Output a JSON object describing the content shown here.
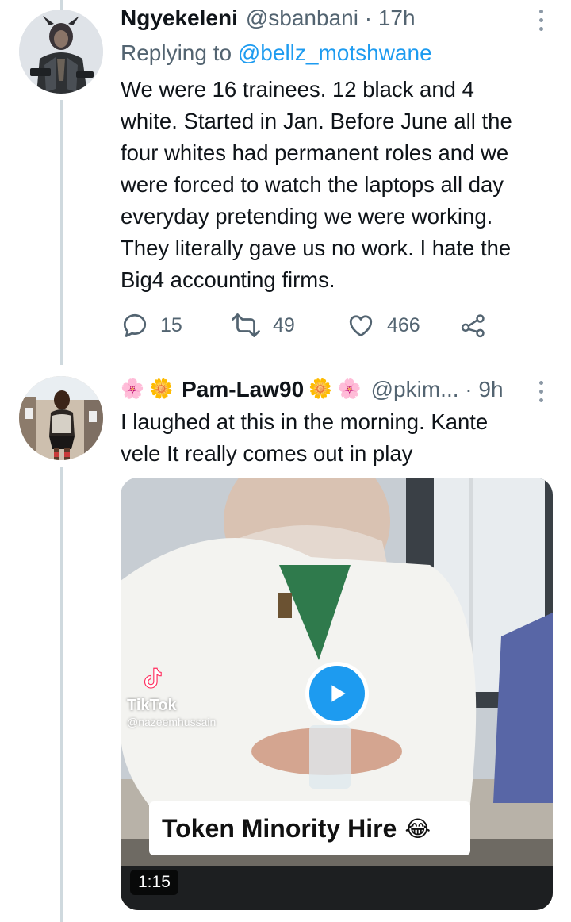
{
  "tweets": [
    {
      "name": "Ngyekeleni",
      "handle": "@sbanbani",
      "separator": " · ",
      "time": "17h",
      "replying_prefix": "Replying to ",
      "replying_to": "@bellz_motshwane",
      "text_lines": [
        "We were 16 trainees. 12 black and 4",
        "white. Started in Jan. Before June all the",
        "four whites had permanent roles and we",
        "were forced to watch the laptops all day",
        "everyday pretending we were working.",
        "They literally gave us no work. I hate the",
        "Big4 accounting firms."
      ],
      "replies": "15",
      "retweets": "49",
      "likes": "466",
      "avatar_icon": "avatar-armored-character"
    },
    {
      "name_prefix_emoji": "🌸 🌼 ",
      "name": "Pam-Law90",
      "name_suffix_emoji": "🌼 🌸",
      "handle": "@pkim...",
      "separator": " · ",
      "time": "9h",
      "text_lines": [
        "I laughed at this in the morning. Kante",
        "vele It really comes out in play"
      ],
      "avatar_icon": "avatar-woman-photo",
      "media": {
        "watermark_brand": "TikTok",
        "watermark_handle": "@nazeemhussain",
        "caption": "Token Minority Hire",
        "caption_emoji": "😂",
        "duration": "1:15"
      }
    }
  ],
  "colors": {
    "accent": "#1d9bf0",
    "secondary_text": "#536471",
    "thread_line": "#cfd9de"
  }
}
